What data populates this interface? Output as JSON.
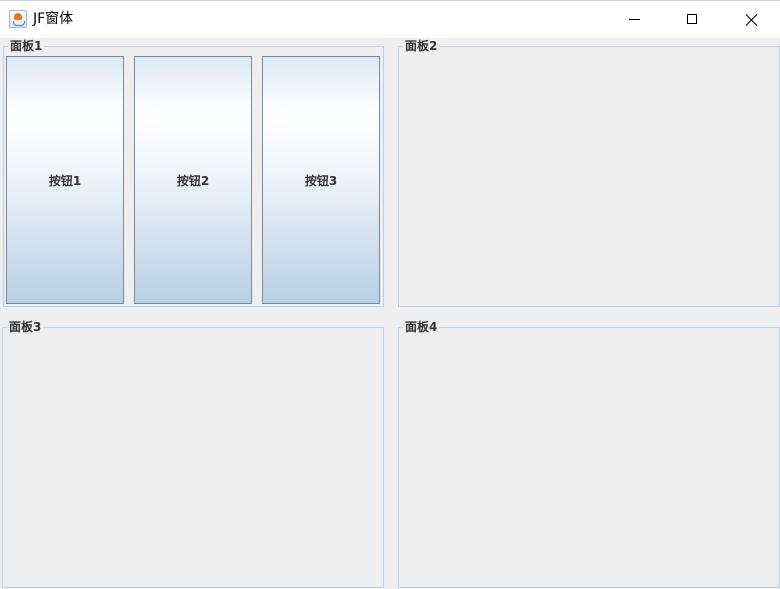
{
  "window": {
    "title": "JF窗体",
    "icon": "java-cup-icon",
    "controls": {
      "minimize": "minimize-icon",
      "maximize": "maximize-icon",
      "close": "close-icon"
    }
  },
  "panels": [
    {
      "title": "面板1"
    },
    {
      "title": "面板2"
    },
    {
      "title": "面板3"
    },
    {
      "title": "面板4"
    }
  ],
  "buttons": [
    {
      "label": "按钮1"
    },
    {
      "label": "按钮2"
    },
    {
      "label": "按钮3"
    }
  ],
  "colors": {
    "background": "#eeeeee",
    "panel_border": "#b8cfe5",
    "button_border": "#7a8a99",
    "button_gradient_top": "#ffffff",
    "button_gradient_bottom": "#b8cfe5"
  }
}
